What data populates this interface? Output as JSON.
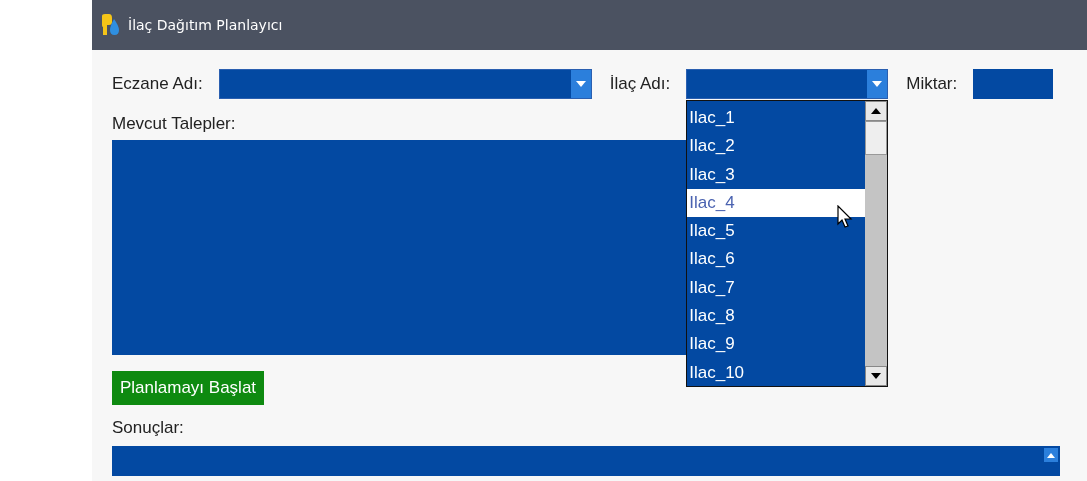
{
  "window": {
    "title": "İlaç Dağıtım Planlayıcı"
  },
  "fields": [
    {
      "kind": "combo",
      "label": "Eczane Adı:"
    },
    {
      "kind": "combo",
      "label": "İlaç Adı:",
      "expanded": true,
      "items": [
        {
          "label": "Ilac_1",
          "selected": false
        },
        {
          "label": "Ilac_2",
          "selected": false
        },
        {
          "label": "Ilac_3",
          "selected": false
        },
        {
          "label": "Ilac_4",
          "selected": true
        },
        {
          "label": "Ilac_5",
          "selected": false
        },
        {
          "label": "Ilac_6",
          "selected": false
        },
        {
          "label": "Ilac_7",
          "selected": false
        },
        {
          "label": "Ilac_8",
          "selected": false
        },
        {
          "label": "Ilac_9",
          "selected": false
        },
        {
          "label": "Ilac_10",
          "selected": false
        }
      ]
    },
    {
      "kind": "text",
      "label": "Miktar:"
    }
  ],
  "requests": {
    "label": "Mevcut Talepler:"
  },
  "start_button": "Planlamayı Başlat",
  "results": {
    "label": "Sonuçlar:"
  }
}
